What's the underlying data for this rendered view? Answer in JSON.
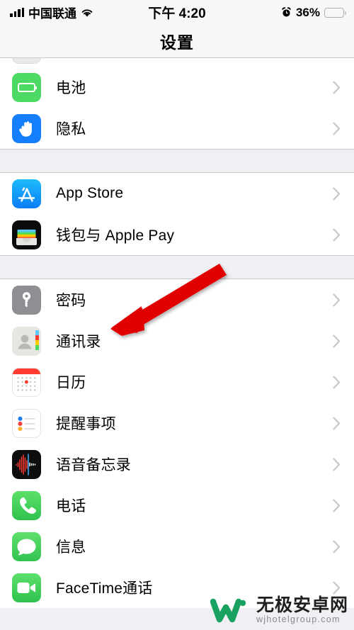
{
  "status_bar": {
    "carrier": "中国联通",
    "time": "下午 4:20",
    "battery_percent": "36%",
    "signal_icon": "signal-bars-icon",
    "wifi_icon": "wifi-icon",
    "alarm_icon": "alarm-clock-icon",
    "battery_icon": "battery-icon",
    "battery_color": "#ffcc00"
  },
  "nav": {
    "title": "设置"
  },
  "groups": [
    {
      "rows": [
        {
          "label": "电池",
          "icon": "battery-icon",
          "icon_color": "#4cd964"
        },
        {
          "label": "隐私",
          "icon": "hand-privacy-icon",
          "icon_color": "#147efb"
        }
      ]
    },
    {
      "rows": [
        {
          "label": "App Store",
          "icon": "app-store-icon",
          "icon_color": "#0a7cf6"
        },
        {
          "label": "钱包与 Apple Pay",
          "icon": "wallet-icon",
          "icon_color": "#0b0b0b"
        }
      ]
    },
    {
      "rows": [
        {
          "label": "密码",
          "icon": "key-passwords-icon",
          "icon_color": "#8e8e93"
        },
        {
          "label": "通讯录",
          "icon": "contacts-icon",
          "icon_color": "#e7e6e1"
        },
        {
          "label": "日历",
          "icon": "calendar-icon",
          "icon_color": "#ff3b30"
        },
        {
          "label": "提醒事项",
          "icon": "reminders-icon",
          "icon_color": "#ffffff"
        },
        {
          "label": "语音备忘录",
          "icon": "voice-memos-icon",
          "icon_color": "#0d0d0d"
        },
        {
          "label": "电话",
          "icon": "phone-icon",
          "icon_color": "#2fc24d"
        },
        {
          "label": "信息",
          "icon": "messages-icon",
          "icon_color": "#33c24f"
        },
        {
          "label": "FaceTime通话",
          "icon": "facetime-icon",
          "icon_color": "#2fc24d"
        }
      ]
    }
  ],
  "annotation": {
    "arrow_color": "#e00000",
    "arrow_target": "密码"
  },
  "watermark": {
    "title": "无极安卓网",
    "subtitle": "wjhotelgroup.com",
    "logo_color": "#19a15f"
  }
}
